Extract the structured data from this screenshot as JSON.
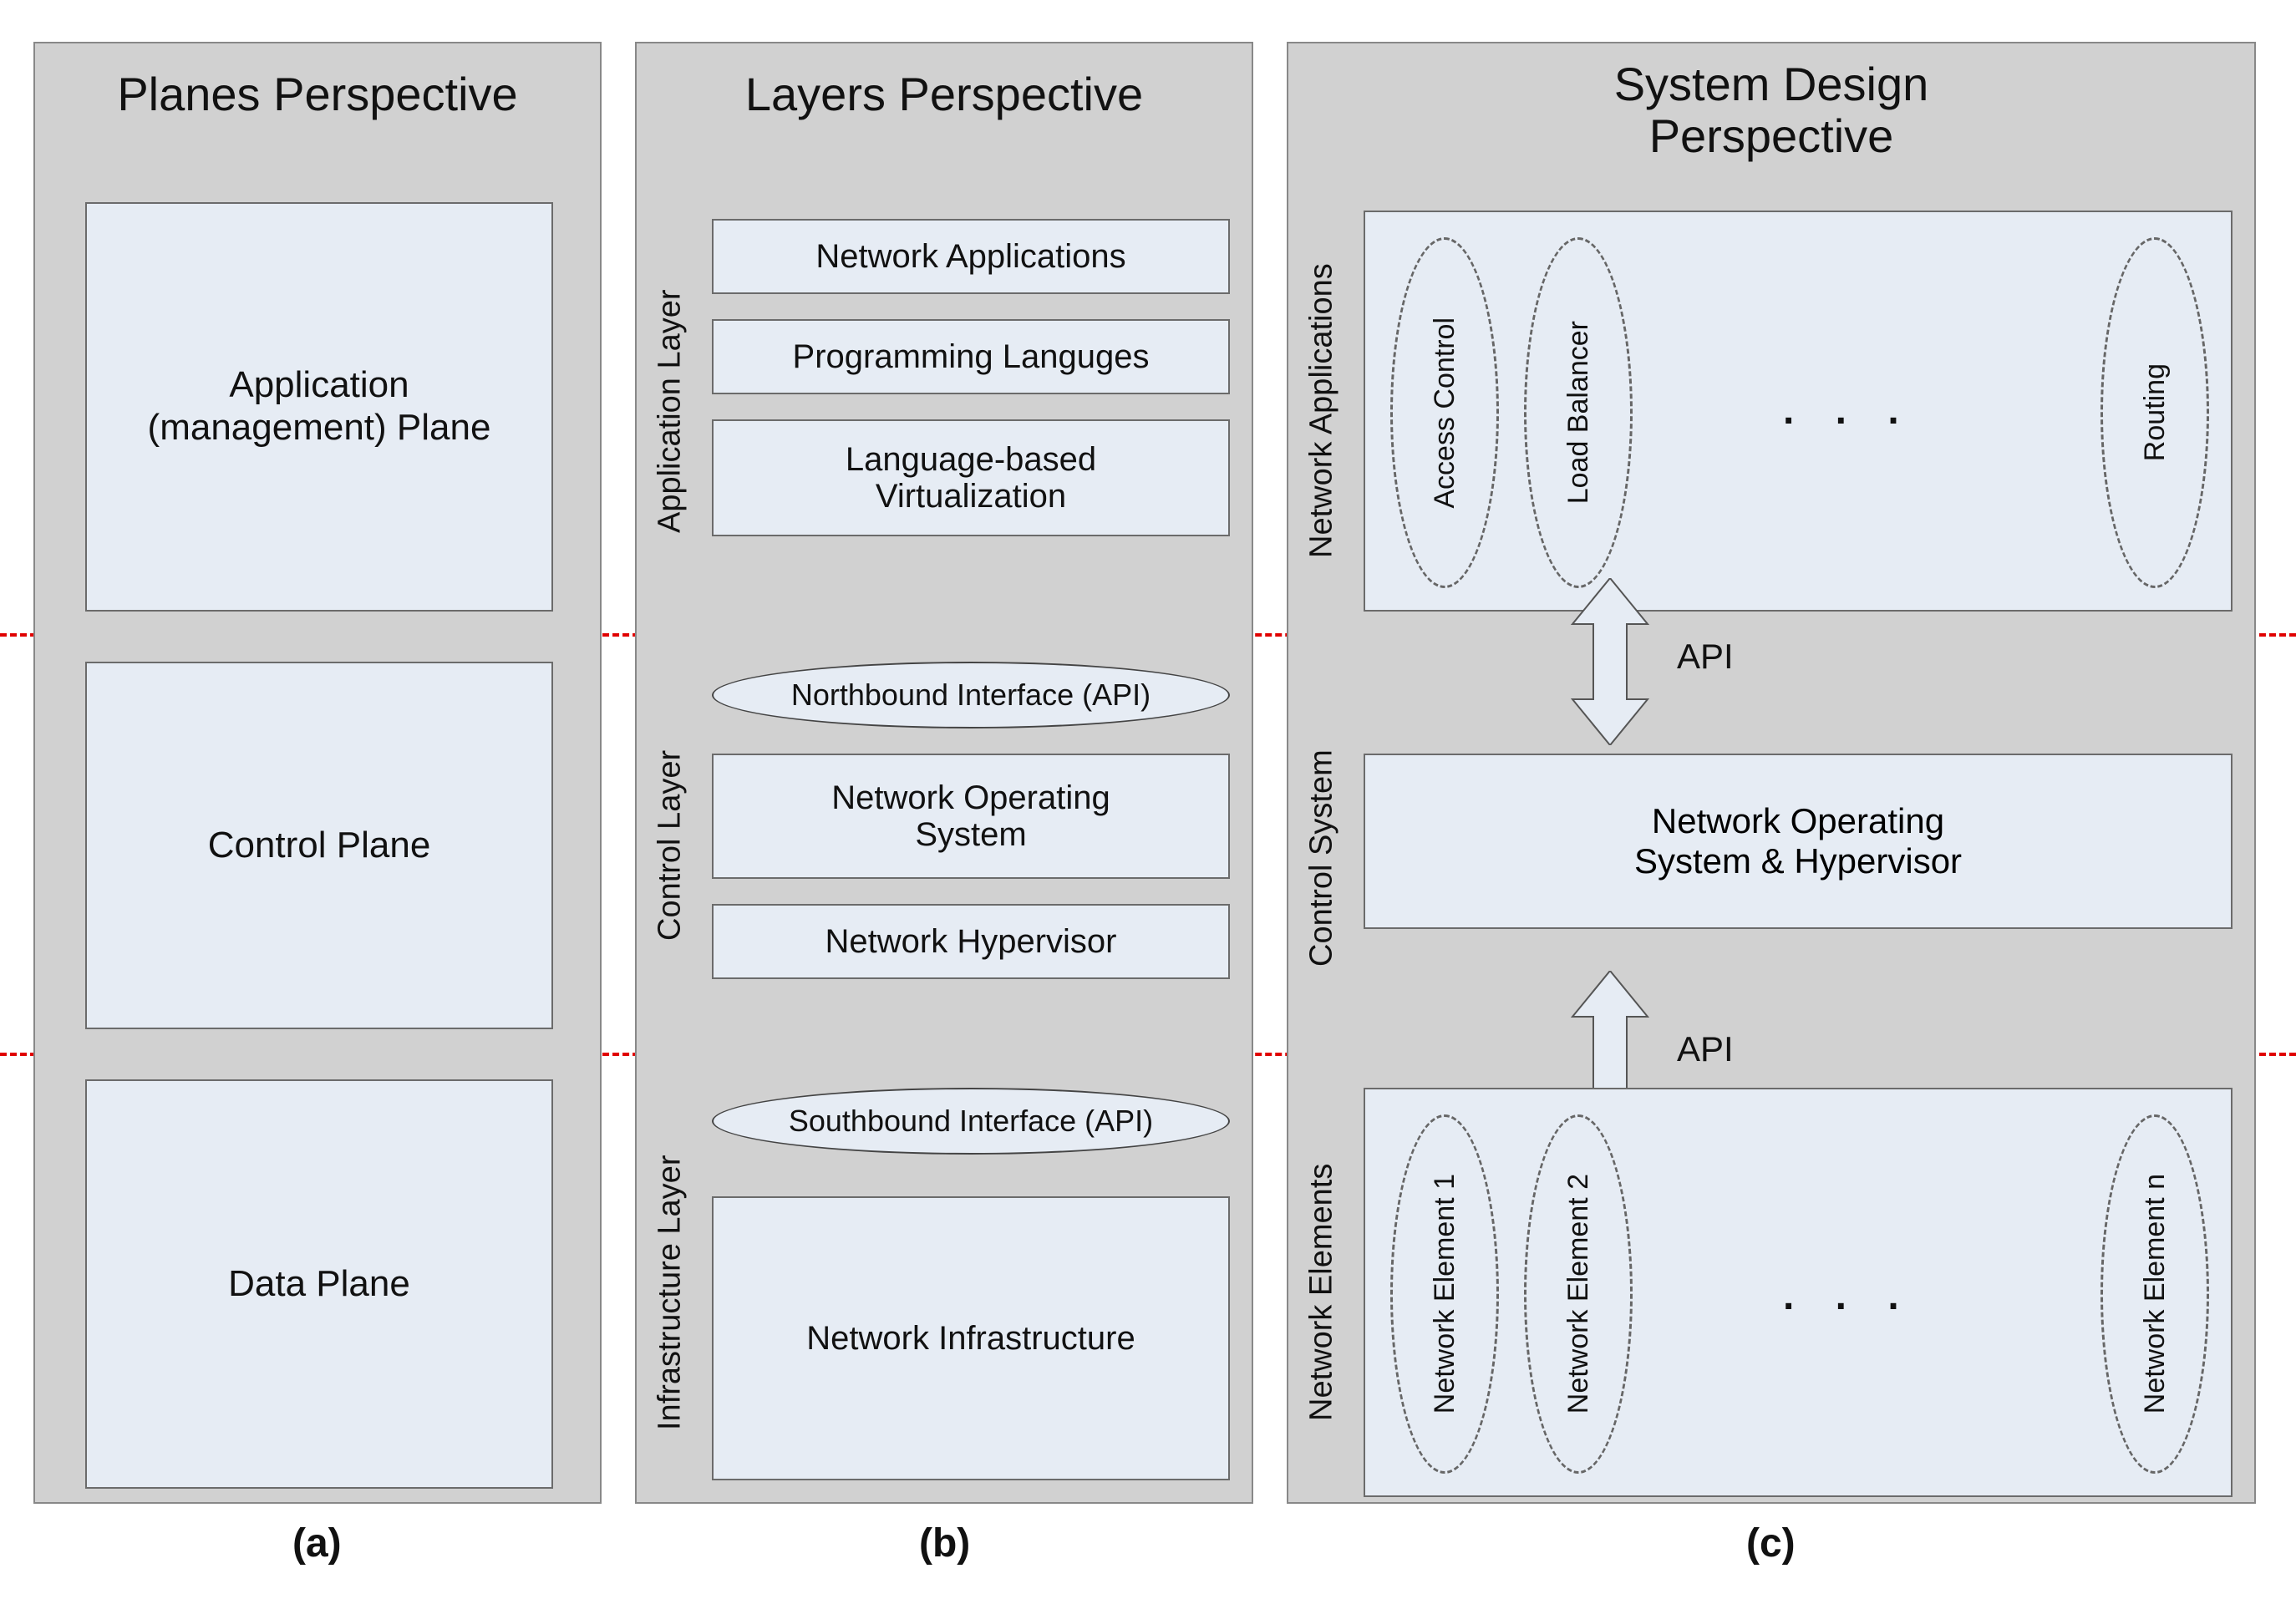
{
  "columns": {
    "a": {
      "title": "Planes Perspective",
      "boxes": {
        "app": "Application\n(management) Plane",
        "control": "Control Plane",
        "data": "Data Plane"
      },
      "label": "(a)"
    },
    "b": {
      "title": "Layers Perspective",
      "layers": {
        "app": {
          "vlabel": "Application Layer",
          "items": {
            "netapps": "Network Applications",
            "prog": "Programming Languges",
            "langvirt": "Language-based\nVirtualization"
          }
        },
        "control": {
          "vlabel": "Control Layer",
          "api": "Northbound Interface (API)",
          "items": {
            "nos": "Network Operating\nSystem",
            "hyp": "Network Hypervisor"
          }
        },
        "infra": {
          "vlabel": "Infrastructure Layer",
          "api": "Southbound Interface (API)",
          "items": {
            "netinfra": "Network Infrastructure"
          }
        }
      },
      "label": "(b)"
    },
    "c": {
      "title": "System Design\nPerspective",
      "sections": {
        "apps": {
          "vlabel": "Network Applications",
          "ellipses": {
            "access": "Access Control",
            "lb": "Load Balancer",
            "routing": "Routing"
          }
        },
        "control": {
          "vlabel": "Control System",
          "box": "Network Operating\nSystem & Hypervisor"
        },
        "elements": {
          "vlabel": "Network Elements",
          "ellipses": {
            "e1": "Network Element 1",
            "e2": "Network Element 2",
            "en": "Network Element n"
          }
        }
      },
      "api_top": "API",
      "api_bottom": "API",
      "label": "(c)"
    },
    "dots": ". . ."
  }
}
